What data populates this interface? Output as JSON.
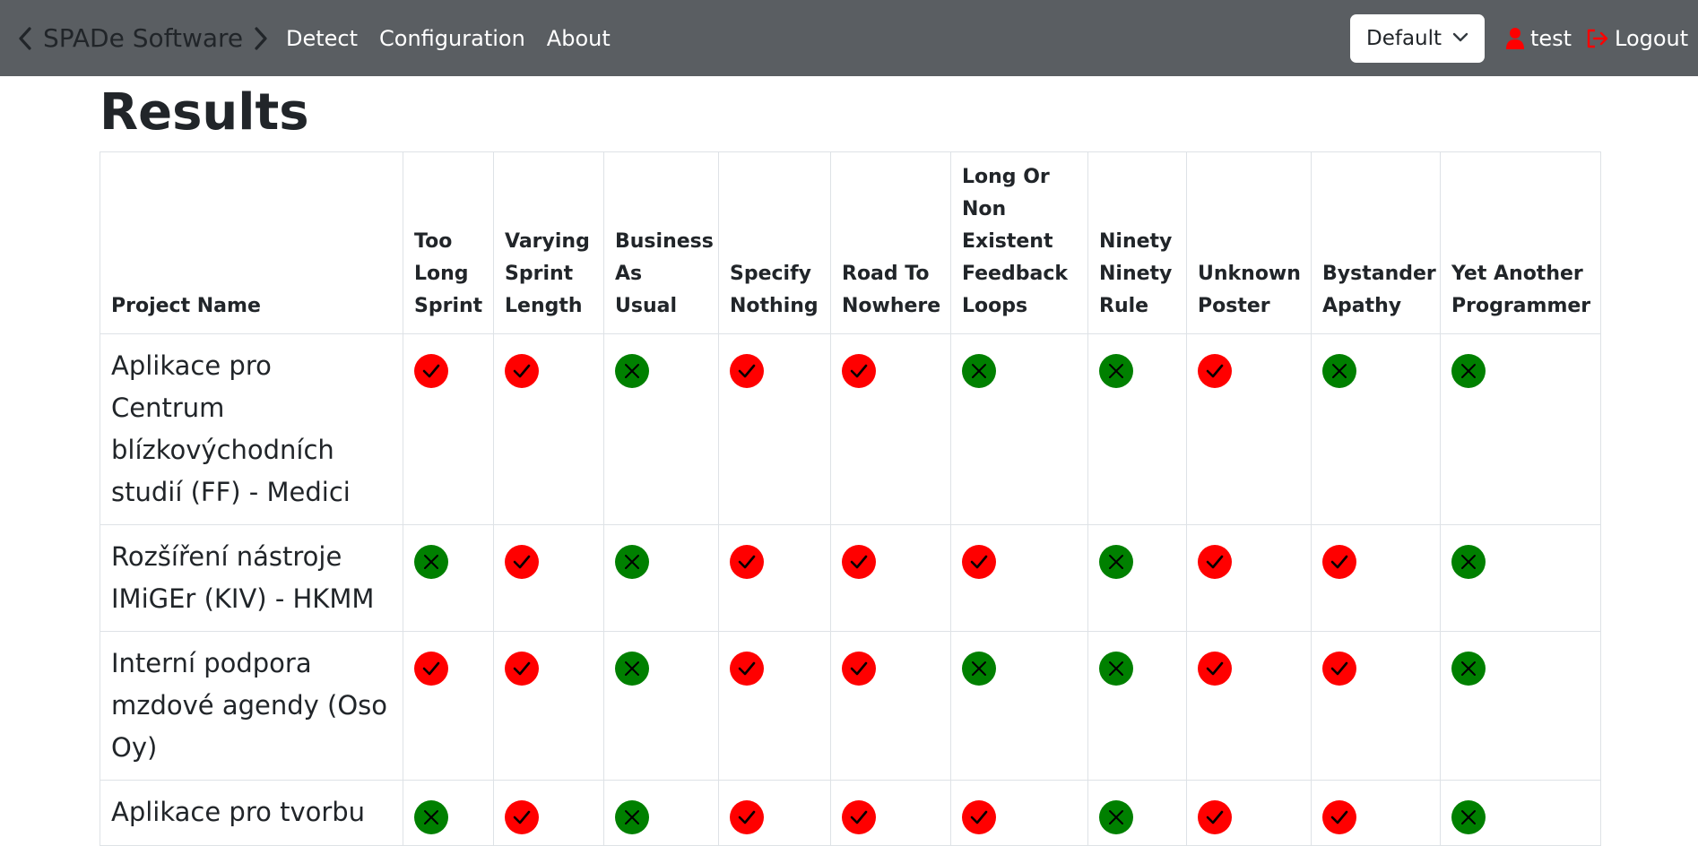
{
  "navbar": {
    "brand": "SPADe Software",
    "links": [
      "Detect",
      "Configuration",
      "About"
    ],
    "config_select": "Default",
    "user": "test",
    "logout": "Logout",
    "icon_color_red": "#ff0000"
  },
  "page": {
    "title": "Results"
  },
  "table": {
    "headers": [
      "Project Name",
      "Too Long Sprint",
      "Varying Sprint Length",
      "Business As Usual",
      "Specify Nothing",
      "Road To Nowhere",
      "Long Or Non Existent Feedback Loops",
      "Ninety Ninety Rule",
      "Unknown Poster",
      "Bystander Apathy",
      "Yet Another Programmer"
    ],
    "rows": [
      {
        "project": "Aplikace pro Centrum blízkovýchodních studií (FF) - Medici",
        "results": [
          "detected",
          "detected",
          "not-detected",
          "detected",
          "detected",
          "not-detected",
          "not-detected",
          "detected",
          "not-detected",
          "not-detected"
        ]
      },
      {
        "project": "Rozšíření nástroje IMiGEr (KIV) - HKMM",
        "results": [
          "not-detected",
          "detected",
          "not-detected",
          "detected",
          "detected",
          "detected",
          "not-detected",
          "detected",
          "detected",
          "not-detected"
        ]
      },
      {
        "project": "Interní podpora mzdové agendy (Oso Oy)",
        "results": [
          "detected",
          "detected",
          "not-detected",
          "detected",
          "detected",
          "not-detected",
          "not-detected",
          "detected",
          "detected",
          "not-detected"
        ]
      },
      {
        "project": "Aplikace pro tvorbu",
        "results": [
          "not-detected",
          "detected",
          "not-detected",
          "detected",
          "detected",
          "detected",
          "not-detected",
          "detected",
          "detected",
          "not-detected"
        ]
      }
    ],
    "colors": {
      "detected": "#ff0000",
      "not_detected": "#008000",
      "border": "#dee2e6"
    },
    "icons": {
      "detected": "check-circle-icon",
      "not_detected": "x-circle-icon"
    }
  }
}
